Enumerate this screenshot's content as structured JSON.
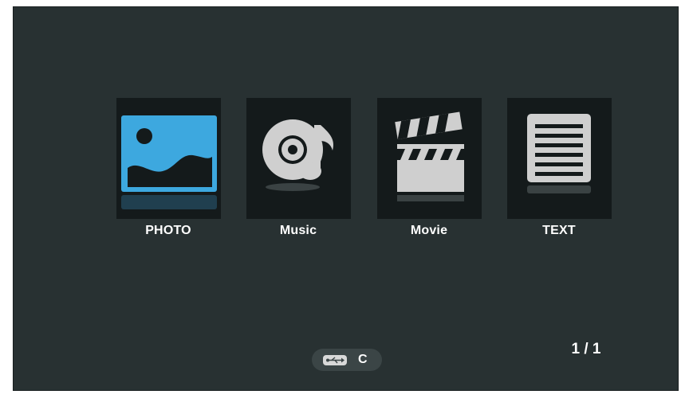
{
  "menu": {
    "items": [
      {
        "label": "PHOTO",
        "icon": "photo-icon",
        "selected": true
      },
      {
        "label": "Music",
        "icon": "music-icon",
        "selected": false
      },
      {
        "label": "Movie",
        "icon": "movie-icon",
        "selected": false
      },
      {
        "label": "TEXT",
        "icon": "text-icon",
        "selected": false
      }
    ]
  },
  "source": {
    "icon": "usb-icon",
    "label": "C"
  },
  "pagination": {
    "text": "1 / 1"
  },
  "colors": {
    "background": "#283132",
    "tile": "#141a1b",
    "accent_blue": "#3da8df",
    "icon_gray": "#cfcfcf",
    "text": "#ffffff"
  }
}
